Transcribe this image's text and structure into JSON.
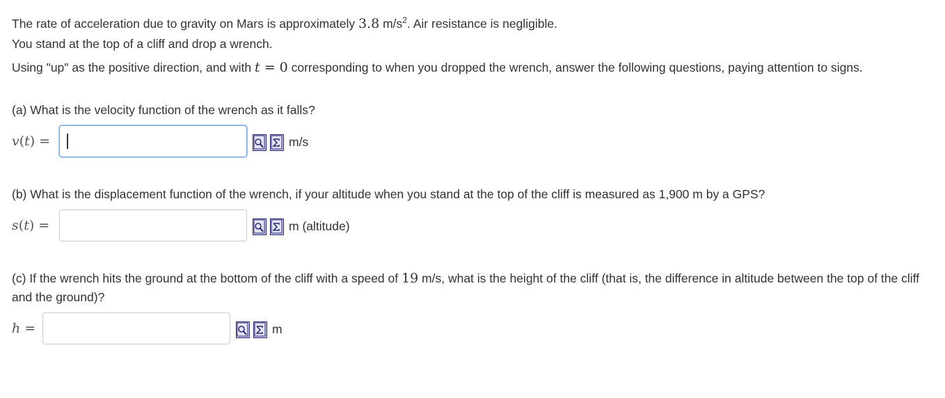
{
  "intro": {
    "line1_pre": "The rate of acceleration due to gravity on Mars is approximately ",
    "line1_value": "3.8",
    "line1_unit": " m/s",
    "line1_exp": "2",
    "line1_post": ".  Air resistance is negligible.",
    "line2": "You stand at the top of a cliff and drop a wrench.",
    "line3_pre": "Using \"up\" as the positive direction, and with ",
    "line3_var": "t",
    "line3_eq": " = ",
    "line3_zero": "0",
    "line3_post": " corresponding to when you dropped the wrench, answer the following questions, paying attention to signs."
  },
  "part_a": {
    "question": "(a) What is the velocity function of the wrench as it falls?",
    "label_var": "v",
    "label_arg": "(",
    "label_t": "t",
    "label_close": ") =",
    "value": "",
    "unit": "m/s"
  },
  "part_b": {
    "question": "(b) What is the displacement function of the wrench, if your altitude when you stand at the top of the cliff is measured as 1,900 m by a GPS?",
    "label_var": "s",
    "label_arg": "(",
    "label_t": "t",
    "label_close": ") =",
    "value": "",
    "unit": "m (altitude)"
  },
  "part_c": {
    "question_pre": "(c) If the wrench hits the ground at the bottom of the cliff with a speed of ",
    "question_value": "19",
    "question_post": " m/s, what is the height of the cliff (that is, the difference in altitude between the top of the cliff and the ground)?",
    "label_var": "h",
    "label_eq": " =",
    "value": "",
    "unit": "m"
  },
  "icons": {
    "preview": "magnifier-preview-icon",
    "equation_editor": "sigma-equation-editor-icon"
  },
  "colors": {
    "focus_border": "#7fa8e0",
    "icon_fill": "#c8c8ee",
    "icon_border": "#2a2a70"
  }
}
